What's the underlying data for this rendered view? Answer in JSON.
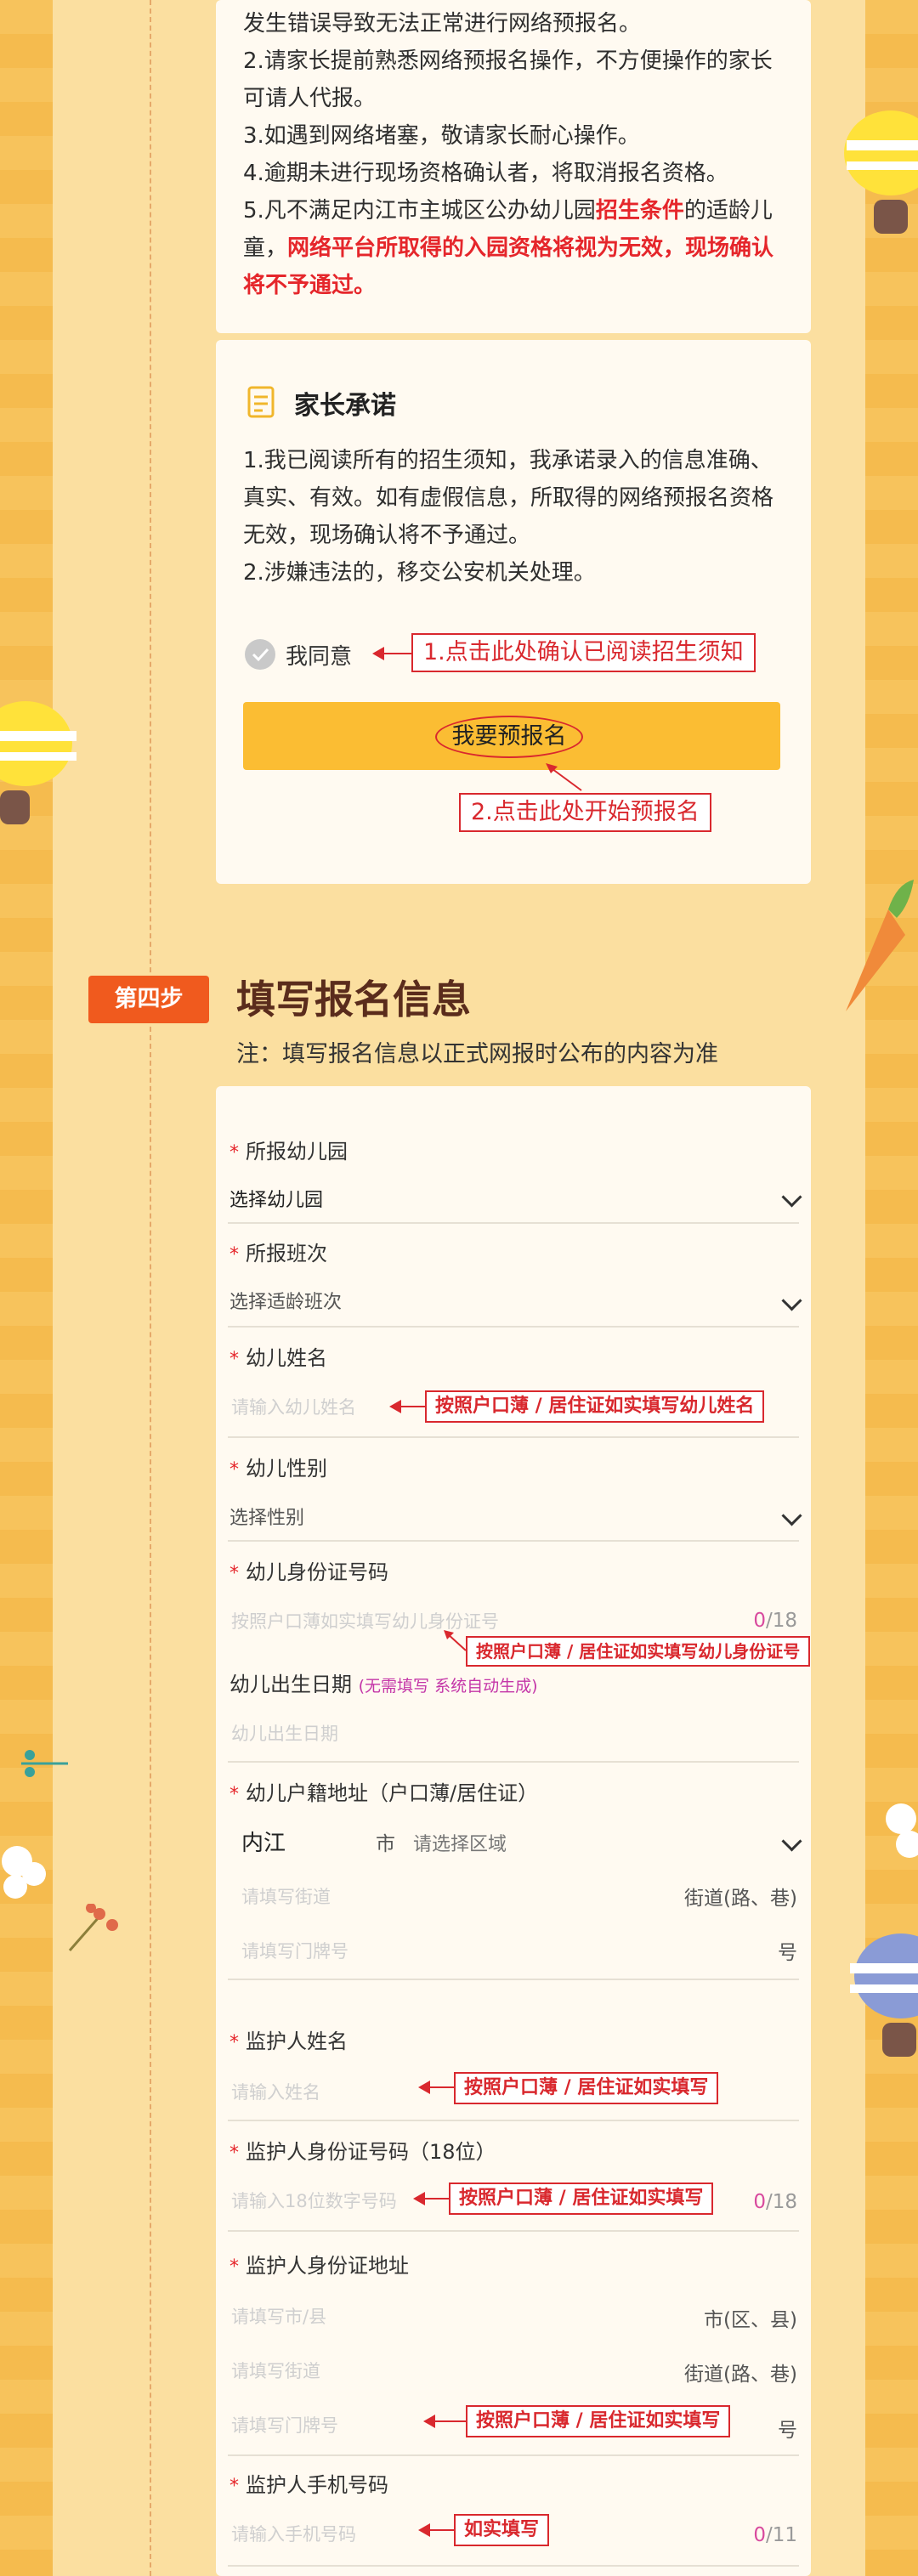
{
  "notice": {
    "line1": "发生错误导致无法正常进行网络预报名。",
    "line2a": "2.请家长提前熟悉网络预报名操作，不方便操作的家长",
    "line2b": "可请人代报。",
    "line3": "3.如遇到网络堵塞，敬请家长耐心操作。",
    "line4": "4.逾期未进行现场资格确认者，将取消报名资格。",
    "line5a_pre": "5.凡不满足内江市主城区公办幼儿园",
    "line5a_red": "招生条件",
    "line5a_post": "的适龄儿",
    "line5b_pre": "童，",
    "line5b_red": "网络平台所取得的入园资格将视为无效，现场确认",
    "line5c_red": "将不予通过。"
  },
  "promise": {
    "title": "家长承诺",
    "p1a": "1.我已阅读所有的招生须知，我承诺录入的信息准确、",
    "p1b": "真实、有效。如有虚假信息，所取得的网络预报名资格",
    "p1c": "无效，现场确认将不予通过。",
    "p2": "2.涉嫌违法的，移交公安机关处理。",
    "agree_label": "我同意",
    "agree_hint": "1.点击此处确认已阅读招生须知",
    "apply_button": "我要预报名",
    "apply_hint": "2.点击此处开始预报名"
  },
  "step4": {
    "badge": "第四步",
    "title": "填写报名信息",
    "note": "注：填写报名信息以正式网报时公布的内容为准"
  },
  "form": {
    "star": "*",
    "kindergarten_label": "所报幼儿园",
    "kindergarten_value": "选择幼儿园",
    "class_label": "所报班次",
    "class_value": "选择适龄班次",
    "child_name_label": "幼儿姓名",
    "child_name_ph": "请输入幼儿姓名",
    "child_name_hint": "按照户口薄 / 居住证如实填写幼儿姓名",
    "gender_label": "幼儿性别",
    "gender_value": "选择性别",
    "child_id_label": "幼儿身份证号码",
    "child_id_ph": "按照户口薄如实填写幼儿身份证号",
    "child_id_count": "0",
    "child_id_max": "/18",
    "child_id_hint": "按照户口薄 / 居住证如实填写幼儿身份证号",
    "birth_label": "幼儿出生日期",
    "birth_note": "(无需填写 系统自动生成)",
    "birth_ph": "幼儿出生日期",
    "address_label": "幼儿户籍地址（户口薄/居住证）",
    "city_value": "内江",
    "city_suffix": "市",
    "district_ph": "请选择区域",
    "street_ph": "请填写街道",
    "street_suffix": "街道(路、巷)",
    "door_ph": "请填写门牌号",
    "door_suffix": "号",
    "guardian_name_label": "监护人姓名",
    "guardian_name_ph": "请输入姓名",
    "guardian_name_hint": "按照户口薄 / 居住证如实填写",
    "guardian_id_label": "监护人身份证号码（18位）",
    "guardian_id_ph": "请输入18位数字号码",
    "guardian_id_hint": "按照户口薄 / 居住证如实填写",
    "guardian_id_count": "0",
    "guardian_id_max": "/18",
    "guardian_addr_label": "监护人身份证地址",
    "g_city_ph": "请填写市/县",
    "g_city_suffix": "市(区、县)",
    "g_street_ph": "请填写街道",
    "g_street_suffix": "街道(路、巷)",
    "g_door_ph": "请填写门牌号",
    "g_door_suffix": "号",
    "g_addr_hint": "按照户口薄 / 居住证如实填写",
    "phone_label": "监护人手机号码",
    "phone_ph": "请输入手机号码",
    "phone_hint": "如实填写",
    "phone_count": "0",
    "phone_max": "/11"
  }
}
